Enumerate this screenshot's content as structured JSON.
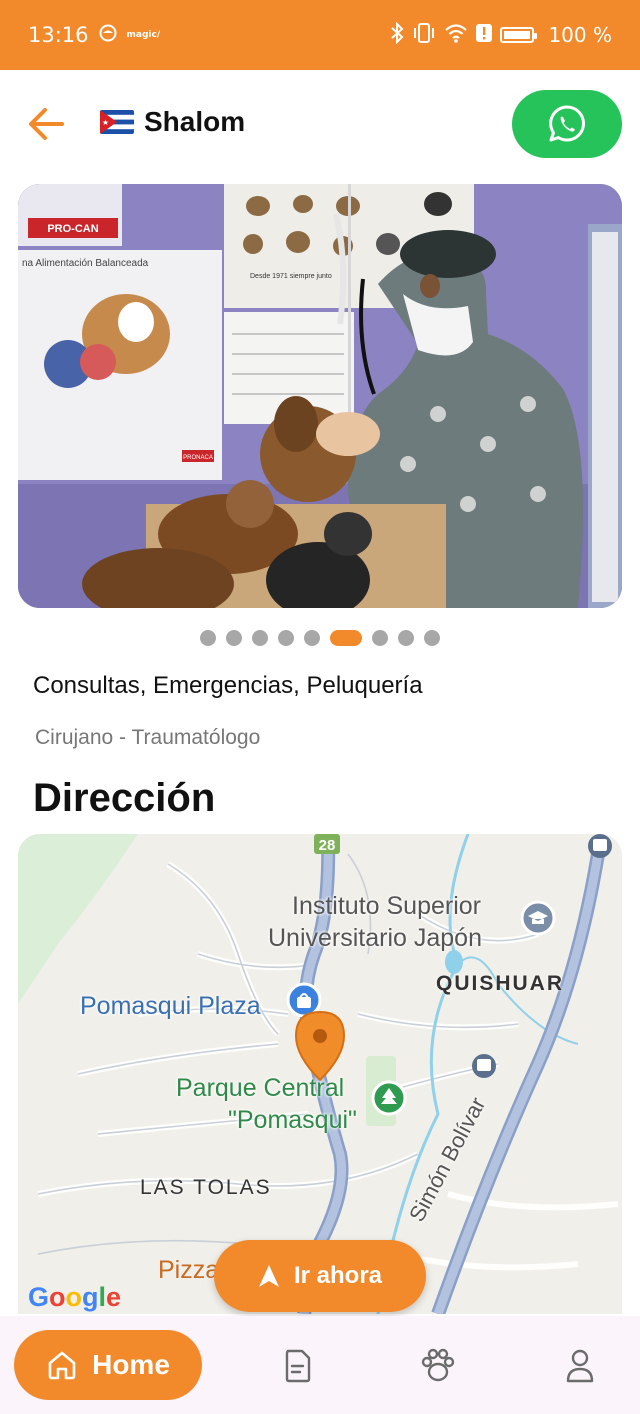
{
  "status_bar": {
    "time": "13:16",
    "small_label": "magic/",
    "battery": "100 %",
    "battery_level": 1.0
  },
  "header": {
    "title": "Shalom",
    "back_icon": "arrow-left-icon",
    "flag_icon": "cuba-flag-icon",
    "whatsapp_icon": "whatsapp-icon"
  },
  "carousel": {
    "image_icon": "vet-photo",
    "photo_texts": {
      "brand": "PRO-CAN",
      "poster": "na Alimentación Balanceada",
      "since": "Desde 1971 siempre junto",
      "logo": "PRONACA"
    },
    "dot_count": 9,
    "active_index": 5
  },
  "info": {
    "services": "Consultas, Emergencias, Peluquería",
    "specialty": "Cirujano - Traumatólogo"
  },
  "section": {
    "address_title": "Dirección"
  },
  "map": {
    "labels": {
      "route": "28",
      "institute_line1": "Instituto Superior",
      "institute_line2": "Universitario Japón",
      "quishuar": "QUISHUAR",
      "plaza": "Pomasqui Plaza",
      "park_line1": "Parque Central",
      "park_line2": "\"Pomasqui\"",
      "las_tolas": "LAS TOLAS",
      "simon": "Simón Bolívar",
      "pizza": "Pizza"
    },
    "google": "Google",
    "go_button": "Ir ahora"
  },
  "bottom_nav": {
    "home_label": "Home",
    "items": [
      "document-icon",
      "paw-icon",
      "profile-icon"
    ]
  },
  "colors": {
    "accent": "#f28a2b",
    "whatsapp": "#25c35a",
    "nav_bg": "#fbf4fb"
  }
}
